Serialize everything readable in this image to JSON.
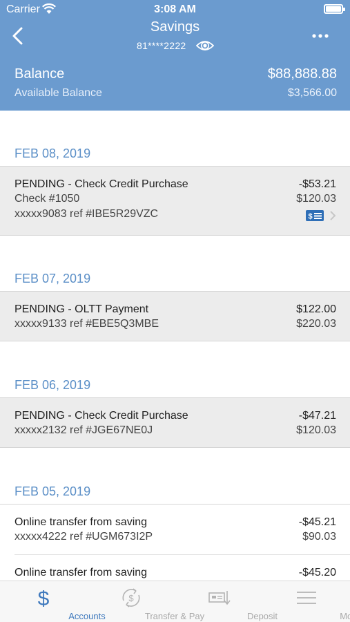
{
  "status": {
    "carrier": "Carrier",
    "time": "3:08 AM"
  },
  "header": {
    "title": "Savings",
    "account": "81****2222",
    "balance_label": "Balance",
    "balance_value": "$88,888.88",
    "available_label": "Available Balance",
    "available_value": "$3,566.00"
  },
  "groups": [
    {
      "date": "FEB 08, 2019",
      "transactions": [
        {
          "desc": "PENDING - Check Credit Purchase",
          "check": "Check #1050",
          "ref": "xxxxx9083 ref #IBE5R29VZC",
          "amount": "-$53.21",
          "balance": "$120.03"
        }
      ]
    },
    {
      "date": "FEB 07, 2019",
      "transactions": [
        {
          "desc": "PENDING - OLTT Payment",
          "ref": "xxxxx9133 ref #EBE5Q3MBE",
          "amount": "$122.00",
          "balance": "$220.03"
        }
      ]
    },
    {
      "date": "FEB 06, 2019",
      "transactions": [
        {
          "desc": "PENDING - Check Credit Purchase",
          "ref": "xxxxx2132 ref #JGE67NE0J",
          "amount": "-$47.21",
          "balance": "$120.03"
        }
      ]
    },
    {
      "date": "FEB 05, 2019",
      "transactions": [
        {
          "desc": "Online transfer from saving",
          "ref": "xxxxx4222 ref #UGM673I2P",
          "amount": "-$45.21",
          "balance": "$90.03"
        },
        {
          "desc": "Online transfer from saving",
          "amount": "-$45.20"
        }
      ]
    }
  ],
  "tabs": [
    {
      "label": "Accounts",
      "icon": "dollar-icon"
    },
    {
      "label": "Transfer & Pay",
      "icon": "transfer-pay-icon"
    },
    {
      "label": "Deposit",
      "icon": "deposit-icon"
    },
    {
      "label": "More",
      "icon": "menu-icon"
    }
  ],
  "colors": {
    "header": "#6b9bcf",
    "date": "#5b8fc7",
    "active_tab": "#3f79bd",
    "inactive_tab": "#a9a9a9",
    "pending_row": "#ececec"
  }
}
